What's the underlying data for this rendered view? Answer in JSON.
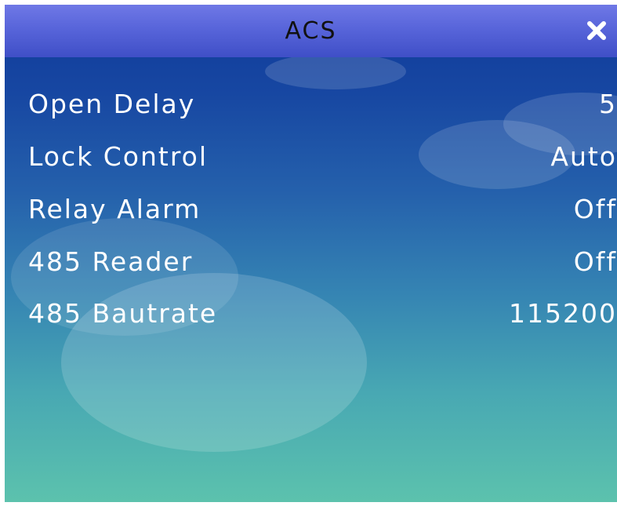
{
  "window": {
    "title": "ACS",
    "close_icon": "close-icon"
  },
  "settings": [
    {
      "label": "Open Delay",
      "value": "5"
    },
    {
      "label": "Lock Control",
      "value": "Auto"
    },
    {
      "label": "Relay Alarm",
      "value": "Off"
    },
    {
      "label": "485 Reader",
      "value": "Off"
    },
    {
      "label": "485 Bautrate",
      "value": "115200"
    }
  ],
  "colors": {
    "titlebar": "#5865da",
    "background_top": "#0f3a9a",
    "background_bottom": "#5cc2ad",
    "text": "#ffffff",
    "title_text": "#111111"
  }
}
